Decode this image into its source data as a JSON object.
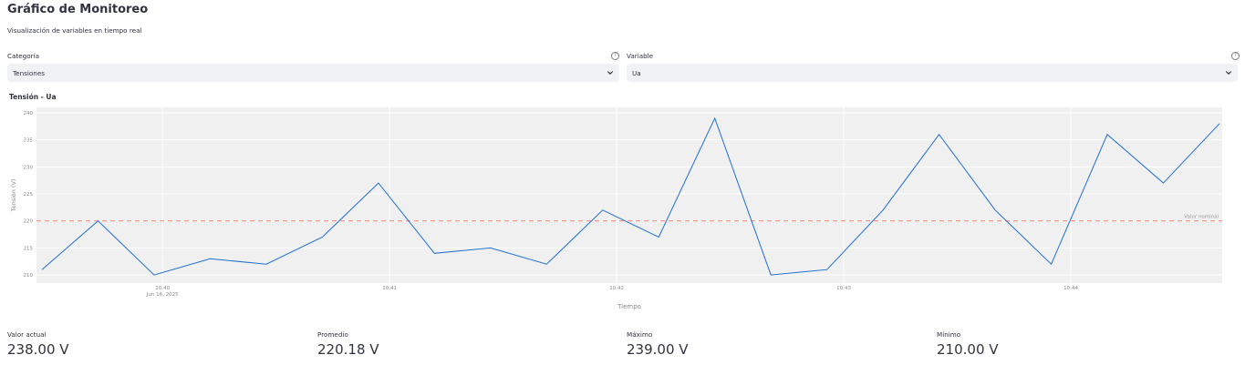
{
  "header": {
    "title": "Gráfico de Monitoreo",
    "subtitle": "Visualización de variables en tiempo real"
  },
  "controls": {
    "category": {
      "label": "Categoría",
      "value": "Tensiones",
      "help": "?"
    },
    "variable": {
      "label": "Variable",
      "value": "Ua",
      "help": "?"
    }
  },
  "chart_data": {
    "type": "line",
    "title": "Tensión - Ua",
    "xlabel": "Tiempo",
    "ylabel": "Tensión (V)",
    "ylim": [
      208.5,
      241
    ],
    "yticks": [
      210,
      215,
      220,
      225,
      230,
      235,
      240
    ],
    "x_tick_labels": [
      "10:40",
      "10:41",
      "10:42",
      "10:43",
      "10:44"
    ],
    "x_date_label": "Jun 16, 2025",
    "grid": true,
    "series": [
      {
        "values": [
          211,
          220,
          210,
          213,
          212,
          217,
          227,
          214,
          215,
          212,
          222,
          217,
          239,
          210,
          211,
          222,
          236,
          222,
          212,
          236,
          227,
          238
        ]
      }
    ],
    "reference_line": {
      "value": 220,
      "label": "Valor nominal",
      "color": "#ff8a80"
    },
    "line_color": "#1f6fd1",
    "background_color": "#f0f0f0"
  },
  "metrics": [
    {
      "label": "Valor actual",
      "value": "238.00 V"
    },
    {
      "label": "Promedio",
      "value": "220.18 V"
    },
    {
      "label": "Máximo",
      "value": "239.00 V"
    },
    {
      "label": "Mínimo",
      "value": "210.00 V"
    }
  ]
}
